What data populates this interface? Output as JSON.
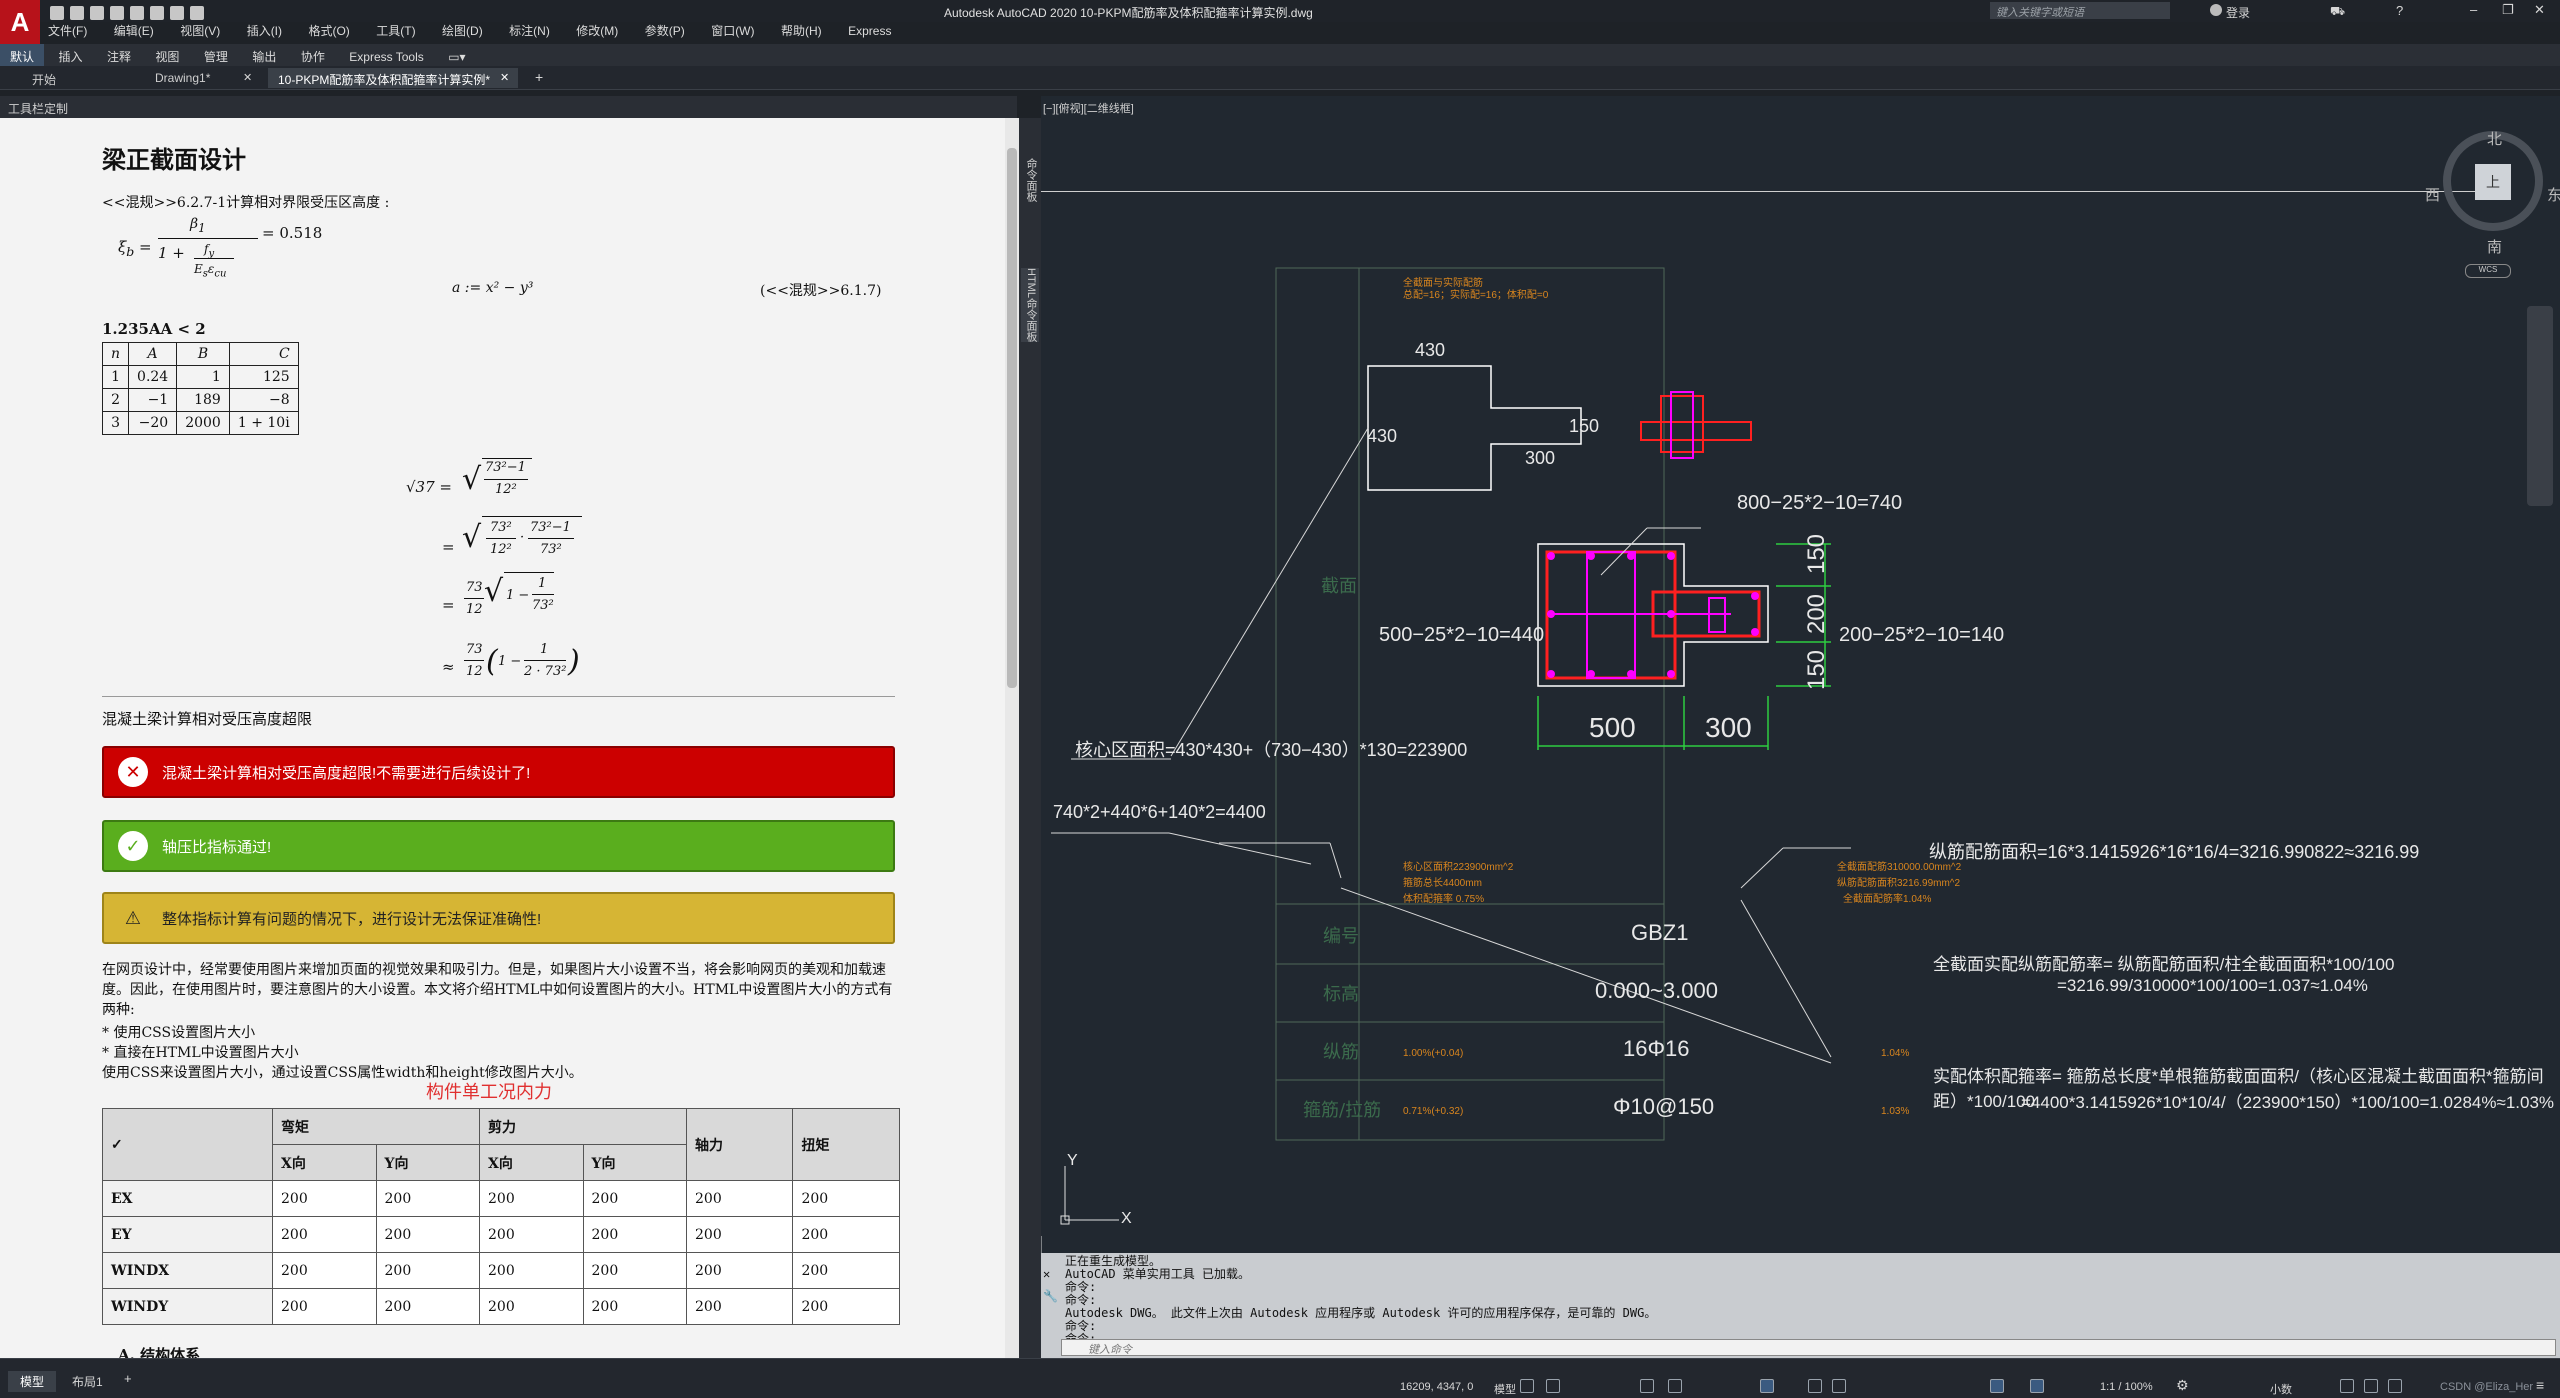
{
  "window": {
    "title": "Autodesk AutoCAD 2020    10-PKPM配筋率及体积配箍率计算实例.dwg",
    "search_placeholder": "键入关键字或短语",
    "login": "登录"
  },
  "menu": [
    "文件(F)",
    "编辑(E)",
    "视图(V)",
    "插入(I)",
    "格式(O)",
    "工具(T)",
    "绘图(D)",
    "标注(N)",
    "修改(M)",
    "参数(P)",
    "窗口(W)",
    "帮助(H)",
    "Express"
  ],
  "ribbon_tabs": [
    "默认",
    "插入",
    "注释",
    "视图",
    "管理",
    "输出",
    "协作",
    "Express Tools"
  ],
  "doc_tabs": [
    "开始",
    "Drawing1*",
    "10-PKPM配筋率及体积配箍率计算实例*"
  ],
  "panel_header": "工具栏定制",
  "doc": {
    "title": "梁正截面设计",
    "ref_line": "<<混规>>6.2.7-1计算相对界限受压区高度 :",
    "xi_result": "= 0.518",
    "eq_a": "a := x² − y³",
    "eq_ref": "(<<混规>>6.1.7)",
    "cond": "1.235AA < 2",
    "table_headers": [
      "n",
      "A",
      "B",
      "C"
    ],
    "table_rows": [
      [
        "1",
        "0.24",
        "1",
        "125"
      ],
      [
        "2",
        "−1",
        "189",
        "−8"
      ],
      [
        "3",
        "−20",
        "2000",
        "1 + 10i"
      ]
    ],
    "sqrt_lines": [
      "√37 =",
      "=",
      "=",
      "≈"
    ],
    "section_label": "混凝土梁计算相对受压高度超限",
    "alert_red": "混凝土梁计算相对受压高度超限!不需要进行后续设计了!",
    "alert_green": "轴压比指标通过!",
    "alert_yellow": "整体指标计算有问题的情况下，进行设计无法保证准确性!",
    "para": "在网页设计中，经常要使用图片来增加页面的视觉效果和吸引力。但是，如果图片大小设置不当，将会影响网页的美观和加载速度。因此，在使用图片时，要注意图片的大小设置。本文将介绍HTML中如何设置图片的大小。HTML中设置图片大小的方式有两种:",
    "bullet1": "* 使用CSS设置图片大小",
    "bullet2": "* 直接在HTML中设置图片大小",
    "para2": "使用CSS来设置图片大小，通过设置CSS属性width和height修改图片大小。",
    "loads_caption": "构件单工况内力",
    "loads_check": "✓",
    "loads_groups": [
      "弯矩",
      "剪力",
      "轴力",
      "扭矩"
    ],
    "loads_sub": [
      "X向",
      "Y向",
      "X向",
      "Y向"
    ],
    "loads_rows": [
      {
        "name": "EX",
        "vals": [
          "200",
          "200",
          "200",
          "200",
          "200",
          "200"
        ]
      },
      {
        "name": "EY",
        "vals": [
          "200",
          "200",
          "200",
          "200",
          "200",
          "200"
        ]
      },
      {
        "name": "WINDX",
        "vals": [
          "200",
          "200",
          "200",
          "200",
          "200",
          "200"
        ]
      },
      {
        "name": "WINDY",
        "vals": [
          "200",
          "200",
          "200",
          "200",
          "200",
          "200"
        ]
      }
    ],
    "next_heading": "A. 结构体系"
  },
  "side_tabs": [
    "命令面板",
    "HTML命令面板"
  ],
  "viewport": {
    "label": "[−][俯视][二维线框]",
    "compass": {
      "n": "北",
      "s": "南",
      "e": "东",
      "w": "西",
      "center": "上",
      "wcs": "WCS"
    },
    "dims": {
      "d430a": "430",
      "d430b": "430",
      "d150a": "150",
      "d300a": "300",
      "label_740": "800−25*2−10=740",
      "label_440": "500−25*2−10=440",
      "label_140": "200−25*2−10=140",
      "d150b": "150",
      "d200": "200",
      "d150c": "150",
      "d500": "500",
      "d300b": "300"
    },
    "notes": {
      "core_area": "核心区面积=430*430+（730−430）*130=223900",
      "perimeter": "740*2+440*6+140*2=4400",
      "rebar_area": "纵筋配筋面积=16*3.1415926*16*16/4=3216.990822≈3216.99",
      "full_ratio_1": "全截面实配纵筋配筋率= 纵筋配筋面积/柱全截面面积*100/100",
      "full_ratio_2": "=3216.99/310000*100/100=1.037≈1.04%",
      "vol_ratio_1": "实配体积配箍率= 箍筋总长度*单根箍筋截面面积/（核心区混凝土截面面积*箍筋间距）*100/100",
      "vol_ratio_2": "=4400*3.1415926*10*10/4/（223900*150）*100/100=1.0284%≈1.03%"
    },
    "small_notes": [
      "全截面与实际配筋",
      "总配=16；实际配=16；体积配=0",
      "核心区面积223900mm^2",
      "箍筋总长4400mm",
      "体积配箍率 0.75%",
      "全截面配筋310000.00mm^2",
      "纵筋配筋面积3216.99mm^2",
      "全截面配筋率1.04%"
    ],
    "table": {
      "rows": [
        {
          "label": "截面",
          "value": ""
        },
        {
          "label": "编号",
          "value": "GBZ1"
        },
        {
          "label": "标高",
          "value": "0.000~3.000"
        },
        {
          "label": "纵筋",
          "value": "16Φ16",
          "left_note": "1.00%(+0.04)",
          "right_note": "1.04%"
        },
        {
          "label": "箍筋/拉筋",
          "value": "Φ10@150",
          "left_note": "0.71%(+0.32)",
          "right_note": "1.03%"
        }
      ]
    },
    "ucs": {
      "x": "X",
      "y": "Y"
    }
  },
  "command": {
    "lines": [
      "正在重生成模型。",
      "AutoCAD 菜单实用工具 已加载。",
      "命令:",
      "命令:",
      "Autodesk DWG。 此文件上次由 Autodesk 应用程序或 Autodesk 许可的应用程序保存，是可靠的 DWG。",
      "命令:",
      "命令:"
    ],
    "placeholder": "键入命令"
  },
  "status": {
    "layout_tabs": [
      "模型",
      "布局1"
    ],
    "coords": "16209, 4347, 0",
    "model": "模型",
    "scale": "1:1 / 100%",
    "units": "小数",
    "watermark": "CSDN @Eliza_Her"
  }
}
